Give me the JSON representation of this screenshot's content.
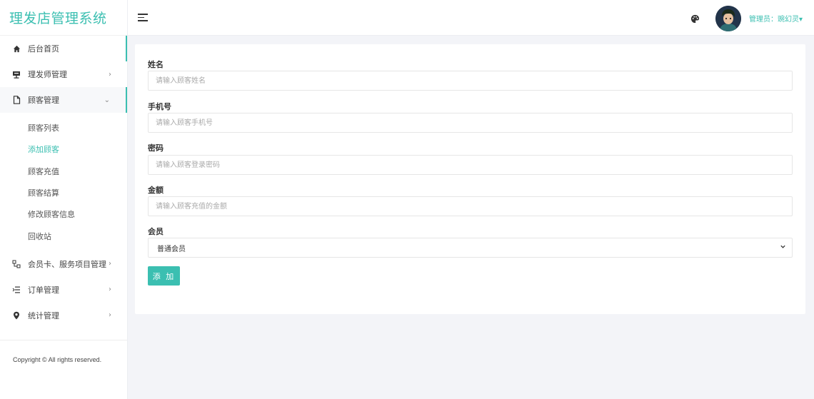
{
  "app": {
    "title": "理发店管理系统"
  },
  "header": {
    "user_label": "管理员：豌幻灵▾"
  },
  "sidebar": {
    "items": [
      {
        "label": "后台首页",
        "icon": "home-icon"
      },
      {
        "label": "理发师管理",
        "icon": "presenter-icon",
        "chevron": "›"
      },
      {
        "label": "顾客管理",
        "icon": "file-icon",
        "chevron": "⌄"
      },
      {
        "label": "会员卡、服务项目管理",
        "icon": "sitemap-icon",
        "chevron": "›"
      },
      {
        "label": "订单管理",
        "icon": "list-icon",
        "chevron": "›"
      },
      {
        "label": "统计管理",
        "icon": "location-icon",
        "chevron": "›"
      }
    ],
    "submenu": [
      {
        "label": "顾客列表"
      },
      {
        "label": "添加顾客"
      },
      {
        "label": "顾客充值"
      },
      {
        "label": "顾客结算"
      },
      {
        "label": "修改顾客信息"
      },
      {
        "label": "回收站"
      }
    ],
    "copyright": "Copyright © All rights reserved."
  },
  "form": {
    "name": {
      "label": "姓名",
      "placeholder": "请输入顾客姓名"
    },
    "phone": {
      "label": "手机号",
      "placeholder": "请输入顾客手机号"
    },
    "password": {
      "label": "密码",
      "placeholder": "请输入顾客登录密码"
    },
    "amount": {
      "label": "金额",
      "placeholder": "请输入顾客充值的金额"
    },
    "member": {
      "label": "会员",
      "selected": "普通会员"
    },
    "submit_label": "添 加"
  },
  "colors": {
    "accent": "#3bbfb1",
    "background": "#f3f4f8"
  }
}
